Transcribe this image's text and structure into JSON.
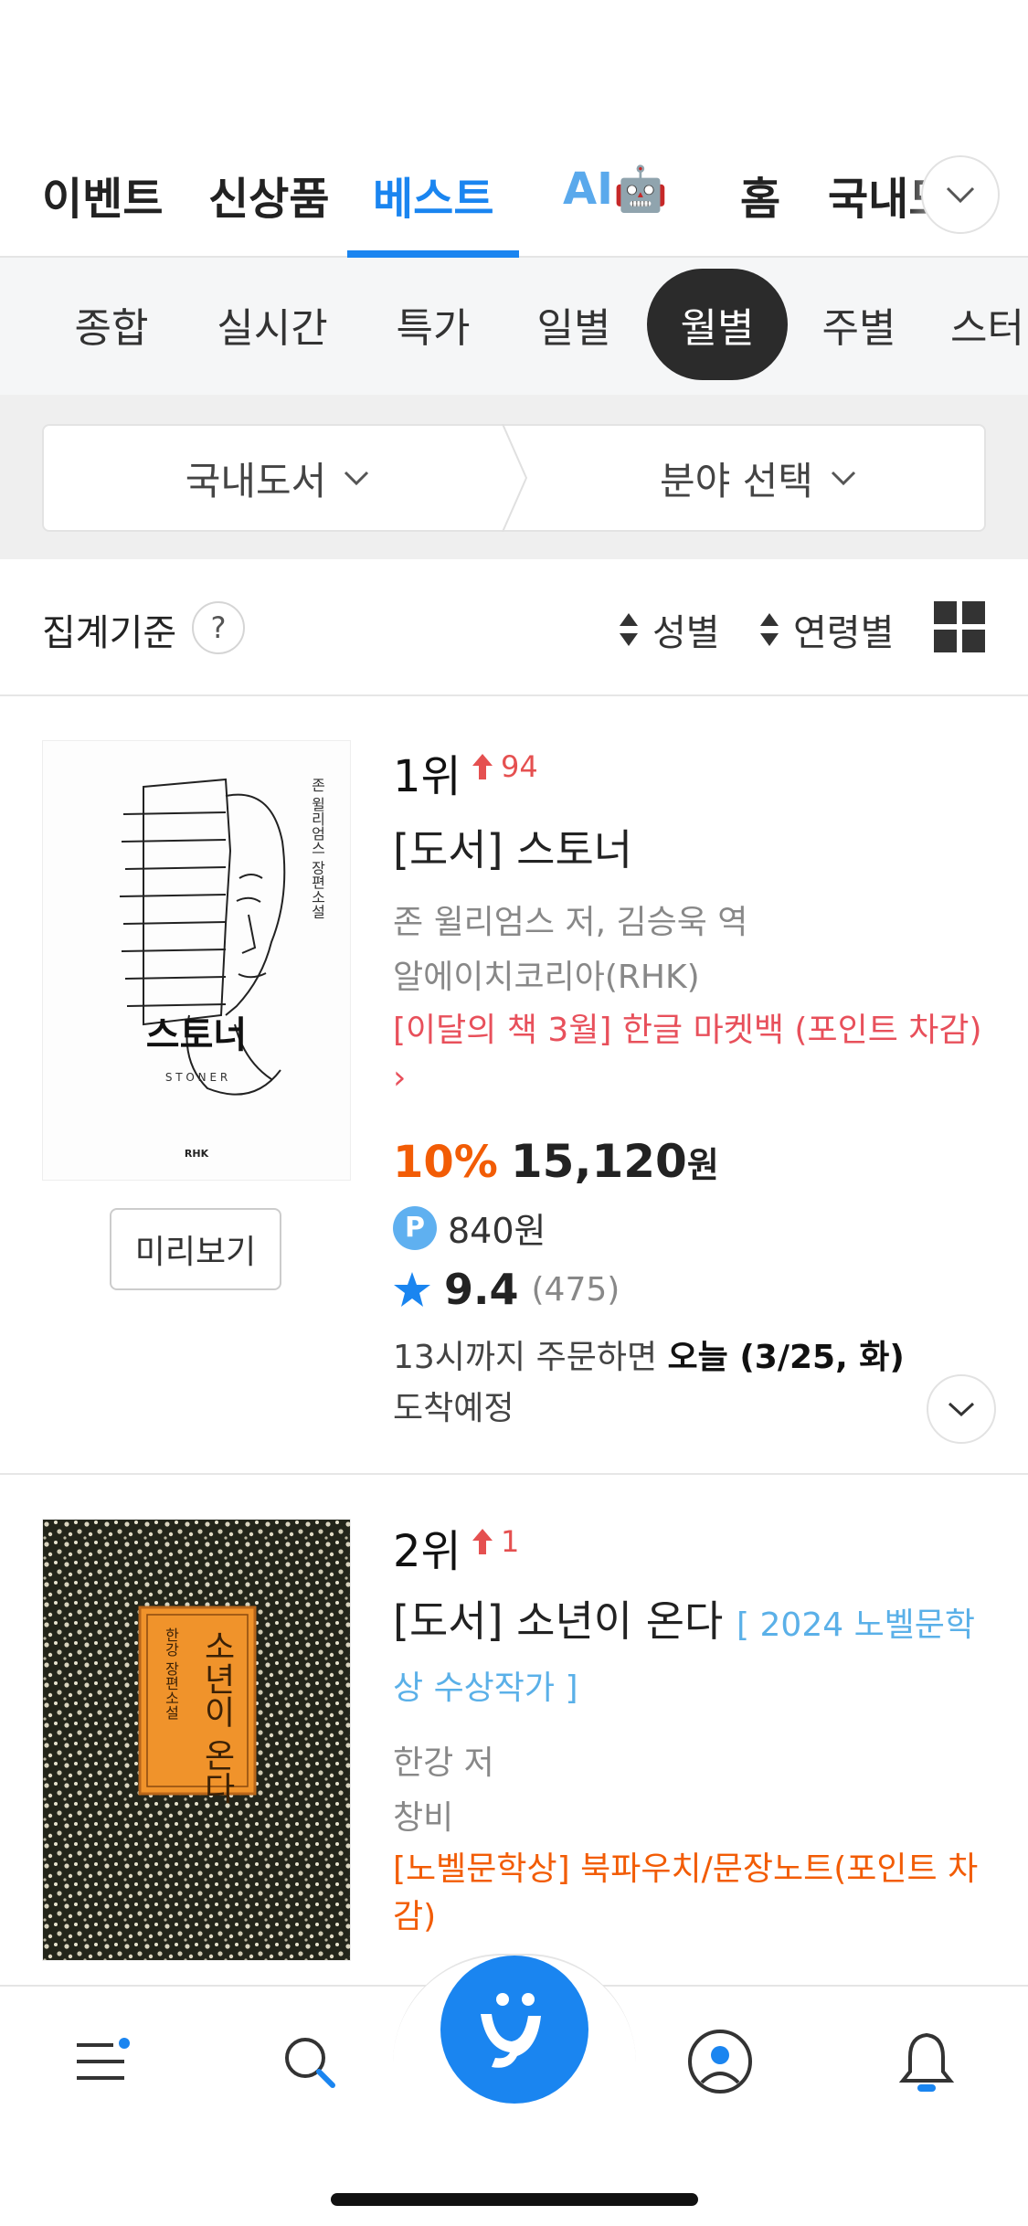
{
  "top_tabs": [
    {
      "label": "이벤트"
    },
    {
      "label": "신상품"
    },
    {
      "label": "베스트"
    },
    {
      "label": "AI🤖"
    },
    {
      "label": "홈"
    },
    {
      "label": "국내도"
    }
  ],
  "period_tabs": [
    {
      "label": "종합"
    },
    {
      "label": "실시간"
    },
    {
      "label": "특가"
    },
    {
      "label": "일별"
    },
    {
      "label": "월별"
    },
    {
      "label": "주별"
    },
    {
      "label": "스터"
    }
  ],
  "filter": {
    "category": "국내도서",
    "field": "분야 선택"
  },
  "criteria": {
    "label": "집계기준",
    "help": "?",
    "gender": "성별",
    "age": "연령별"
  },
  "books": [
    {
      "rank": "1위",
      "rank_change": "94",
      "title": "[도서] 스토너",
      "author": "존 윌리엄스 저, 김승욱 역",
      "publisher": "알에이치코리아(RHK)",
      "promo": "[이달의 책 3월] 한글 마켓백 (포인트 차감)",
      "promo_arrow": "›",
      "discount": "10%",
      "price": "15,120",
      "price_unit": "원",
      "points_badge": "P",
      "points": "840원",
      "rating": "9.4",
      "reviews": "(475)",
      "delivery_prefix": "13시까지 주문하면 ",
      "delivery_bold": "오늘 (3/25, 화)",
      "delivery_suffix": "도착예정",
      "preview": "미리보기",
      "cover": {
        "title": "스토너",
        "latin": "S T O N E R",
        "spine": "존 윌리엄스 장편소설",
        "publisher_logo": "RHK"
      }
    },
    {
      "rank": "2위",
      "rank_change": "1",
      "title": "[도서] 소년이 온다",
      "badge": "[ 2024 노벨문학상 수상작가 ]",
      "author": "한강 저",
      "publisher": "창비",
      "promo": "[노벨문학상] 북파우치/문장노트(포인트 차감)",
      "cover": {
        "title": "소년이 온다",
        "subtitle": "한강 장편소설"
      }
    }
  ],
  "bottom_nav": [
    "menu-icon",
    "search-icon",
    "yes24-logo",
    "my-page-icon",
    "bell-icon"
  ],
  "colors": {
    "accent": "#1a85f0",
    "discount": "#f25c05",
    "promo": "#e8505b",
    "rank_up": "#e55050"
  }
}
